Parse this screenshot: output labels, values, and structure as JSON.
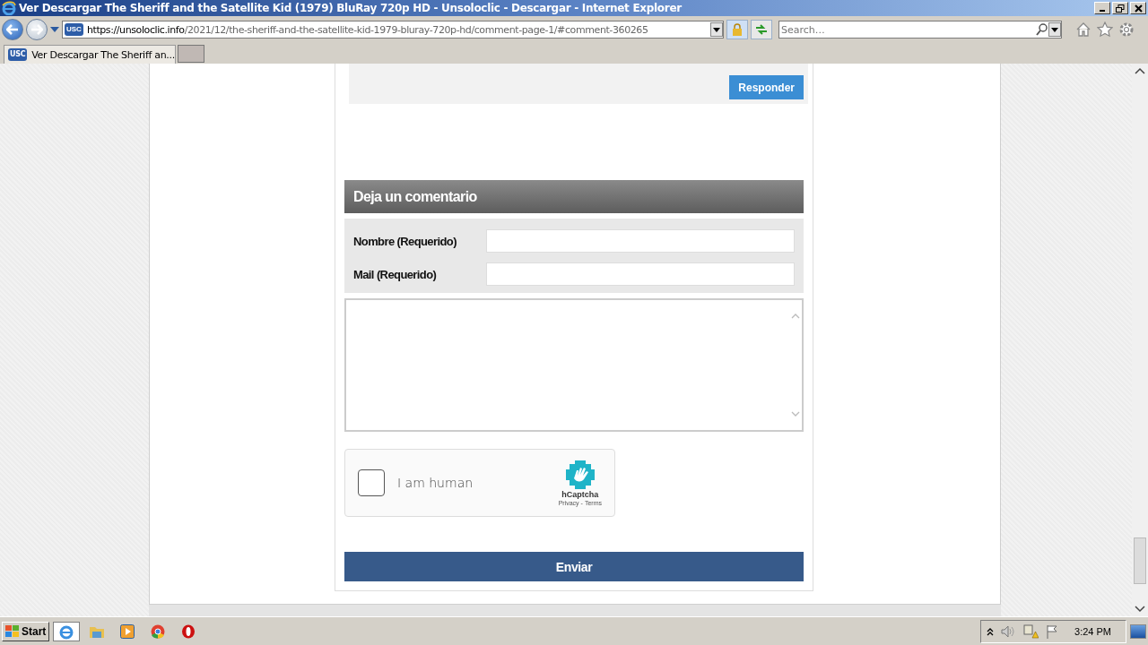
{
  "window": {
    "title": "Ver Descargar The Sheriff and the Satellite Kid (1979) BluRay 720p HD - Unsoloclic - Descargar  - Internet Explorer"
  },
  "address_bar": {
    "favicon": "USC",
    "url_host": "https://unsoloclic.info",
    "url_path": "/2021/12/the-sheriff-and-the-satellite-kid-1979-bluray-720p-hd/comment-page-1/#comment-360265"
  },
  "search": {
    "placeholder": "Search…"
  },
  "tabs": [
    {
      "favicon": "USC",
      "label": "Ver Descargar The Sheriff an...",
      "selected": true
    }
  ],
  "comment": {
    "reply_button": "Responder"
  },
  "form": {
    "heading": "Deja un comentario",
    "fields": [
      {
        "label": "Nombre (Requerido)"
      },
      {
        "label": "Mail (Requerido)"
      }
    ],
    "captcha": {
      "checked": false,
      "label": "I am human",
      "brand": "hCaptcha",
      "links": [
        "Privacy",
        "Terms"
      ],
      "separator": "-"
    },
    "submit": "Enviar"
  },
  "taskbar": {
    "start": "Start",
    "time": "3:24 PM"
  }
}
